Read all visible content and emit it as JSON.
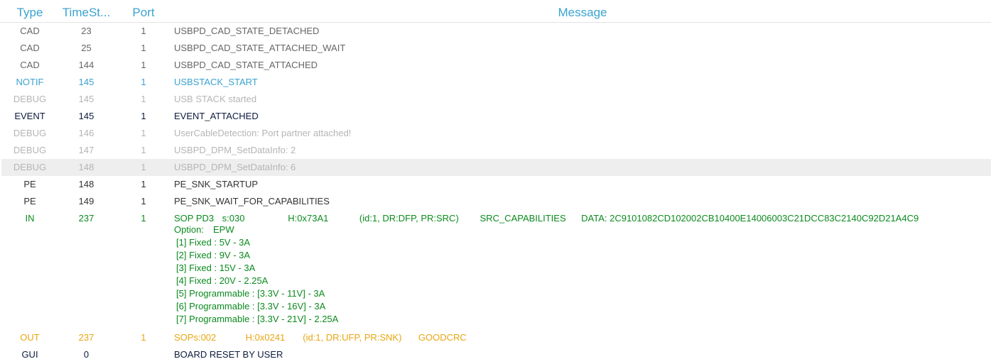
{
  "headers": {
    "type": "Type",
    "timestamp": "TimeSt...",
    "port": "Port",
    "message": "Message"
  },
  "rows": [
    {
      "type": "CAD",
      "ts": "23",
      "port": "1",
      "msg": "USBPD_CAD_STATE_DETACHED"
    },
    {
      "type": "CAD",
      "ts": "25",
      "port": "1",
      "msg": "USBPD_CAD_STATE_ATTACHED_WAIT"
    },
    {
      "type": "CAD",
      "ts": "144",
      "port": "1",
      "msg": "USBPD_CAD_STATE_ATTACHED"
    },
    {
      "type": "NOTIF",
      "ts": "145",
      "port": "1",
      "msg": "USBSTACK_START"
    },
    {
      "type": "DEBUG",
      "ts": "145",
      "port": "1",
      "msg": "USB STACK started"
    },
    {
      "type": "EVENT",
      "ts": "145",
      "port": "1",
      "msg": "EVENT_ATTACHED"
    },
    {
      "type": "DEBUG",
      "ts": "146",
      "port": "1",
      "msg": "UserCableDetection: Port partner attached!"
    },
    {
      "type": "DEBUG",
      "ts": "147",
      "port": "1",
      "msg": "USBPD_DPM_SetDataInfo: 2"
    },
    {
      "type": "DEBUG",
      "ts": "148",
      "port": "1",
      "msg": "USBPD_DPM_SetDataInfo: 6"
    },
    {
      "type": "PE",
      "ts": "148",
      "port": "1",
      "msg": "PE_SNK_STARTUP"
    },
    {
      "type": "PE",
      "ts": "149",
      "port": "1",
      "msg": "PE_SNK_WAIT_FOR_CAPABILITIES"
    },
    {
      "type": "IN",
      "ts": "237",
      "port": "1",
      "fields": [
        "SOP PD3",
        "s:030",
        "H:0x73A1",
        "(id:1, DR:DFP, PR:SRC)",
        "SRC_CAPABILITIES",
        "DATA: 2C9101082CD102002CB10400E14006003C21DCC83C2140C92D21A4C9"
      ],
      "option_label": "Option:",
      "option_value": "EPW",
      "pdos": [
        "[1] Fixed : 5V - 3A",
        "[2] Fixed : 9V - 3A",
        "[3] Fixed : 15V - 3A",
        "[4] Fixed : 20V - 2.25A",
        "[5] Programmable : [3.3V - 11V] - 3A",
        "[6] Programmable : [3.3V - 16V] - 3A",
        "[7] Programmable : [3.3V - 21V] - 2.25A"
      ]
    },
    {
      "type": "OUT",
      "ts": "237",
      "port": "1",
      "fields": [
        "SOPs:002",
        "H:0x0241",
        "(id:1, DR:UFP, PR:SNK)",
        "GOODCRC"
      ]
    },
    {
      "type": "GUI",
      "ts": "0",
      "port": "",
      "msg": "BOARD RESET BY USER"
    }
  ],
  "colors": {
    "header": "#3aa3cf",
    "CAD": "#666666",
    "NOTIF": "#3aa3cf",
    "DEBUG": "#b5b5b5",
    "EVENT": "#0d1b3e",
    "PE": "#333333",
    "IN": "#0b8a1e",
    "OUT": "#e8a612",
    "GUI": "#0d1b3e",
    "selected_bg": "#eeeeee"
  }
}
